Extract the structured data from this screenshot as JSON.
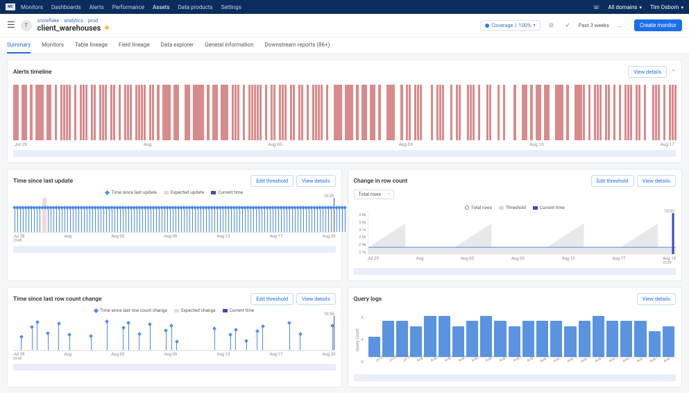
{
  "topnav": {
    "logo_text": "MC",
    "items": [
      "Monitors",
      "Dashboards",
      "Alerts",
      "Performance",
      "Assets",
      "Data products",
      "Settings"
    ],
    "active_index": 4,
    "domain_label": "All domains",
    "user_name": "Tim Osborn"
  },
  "header": {
    "avatar_initial": "T",
    "breadcrumb": [
      "snowflake",
      "analytics",
      "prod"
    ],
    "title": "client_warehouses",
    "coverage_label": "Coverage",
    "coverage_value": "100%",
    "date_range": "Past 3 weeks",
    "create_button": "Create monitor"
  },
  "tabs": {
    "items": [
      "Summary",
      "Monitors",
      "Table lineage",
      "Field lineage",
      "Data explorer",
      "General information",
      "Downstream reports (86+)"
    ],
    "active_index": 0
  },
  "buttons": {
    "view_details": "View details",
    "edit_threshold": "Edit threshold"
  },
  "legends": {
    "time_since_update": [
      "Time since last update",
      "Expected update",
      "Current time"
    ],
    "row_count": [
      "Total rows",
      "Threshold",
      "Current time"
    ],
    "rc_change": [
      "Time since last row count change",
      "Expected change",
      "Current time"
    ]
  },
  "alerts_card": {
    "title": "Alerts timeline",
    "x_ticks": [
      "Jul 29",
      "Aug",
      "Aug 05",
      "Aug 09",
      "Aug 13",
      "Aug 17"
    ]
  },
  "tsu_card": {
    "title": "Time since last update",
    "current_time_label": "10:35",
    "x_ticks": [
      "Jul 28",
      "Aug",
      "Aug 05",
      "Aug 09",
      "Aug 13",
      "Aug 17",
      "Aug 20"
    ],
    "x_tick_sub_first": "23:45"
  },
  "rowcount_card": {
    "title": "Change in row count",
    "selector": "Total rows",
    "current_time_label": "10:35",
    "y_ticks": [
      "3.8k",
      "3.5k",
      "3.1k",
      "2.8k",
      "2.4k",
      "2.1k"
    ],
    "x_ticks": [
      "Jul 29",
      "Aug",
      "Aug 05",
      "Aug 09",
      "Aug 13",
      "Aug 17",
      "Aug 19"
    ],
    "x_tick_sub_last": "23:59"
  },
  "rcchange_card": {
    "title": "Time since last row count change",
    "current_time_label": "10:35",
    "x_ticks": [
      "Jul 28",
      "Aug",
      "Aug 05",
      "Aug 09",
      "Aug 13",
      "Aug 17",
      "Aug 20"
    ],
    "x_tick_sub_first": "23:45"
  },
  "querylogs_card": {
    "title": "Query logs",
    "y_label": "Query Count",
    "y_ticks": [
      "8",
      "4",
      "0"
    ]
  },
  "chart_data": [
    {
      "id": "alerts_timeline",
      "type": "bar",
      "title": "Alerts timeline",
      "xlabel": "",
      "ylabel": "",
      "note": "presence bars; 1 = alert fired in that slot, 0 = none; approx hourly slots over ~3 weeks",
      "values": [
        1,
        1,
        0,
        1,
        1,
        0,
        1,
        0,
        1,
        1,
        1,
        0,
        1,
        1,
        0,
        1,
        0,
        1,
        1,
        1,
        1,
        0,
        1,
        0,
        1,
        1,
        1,
        0,
        1,
        1,
        0,
        1,
        1,
        1,
        0,
        1,
        1,
        0,
        1,
        0,
        1,
        1,
        1,
        0,
        1,
        1,
        1,
        1,
        0,
        1,
        1,
        0,
        1,
        0,
        1,
        1,
        1,
        0,
        1,
        1,
        0,
        0,
        1,
        1,
        0,
        1,
        1,
        1,
        1,
        0,
        1,
        0,
        1,
        1,
        0,
        1,
        1,
        1,
        0,
        1,
        1,
        1,
        0,
        1,
        0,
        1,
        1,
        1,
        1,
        1,
        0,
        1,
        0,
        1,
        1,
        0,
        1,
        1,
        1,
        0,
        1,
        1,
        0,
        1,
        1,
        0,
        1,
        0,
        1,
        1,
        1,
        1,
        0,
        1,
        0,
        0,
        1,
        1,
        1,
        0,
        1,
        1,
        1,
        0,
        1,
        0,
        1,
        1,
        0,
        1,
        1,
        0,
        1,
        0,
        0,
        1,
        1,
        1,
        0,
        0,
        1,
        0,
        1,
        1,
        0,
        1,
        1,
        1,
        0,
        0,
        0,
        1,
        0,
        1,
        1,
        1,
        0,
        0,
        1,
        0,
        1,
        1,
        0,
        0,
        1,
        1,
        1,
        0,
        1,
        0,
        0,
        1,
        1,
        0,
        0,
        1,
        0,
        1,
        0,
        0,
        0,
        1,
        0,
        0,
        1,
        1,
        0,
        1,
        0,
        1,
        1,
        0,
        1,
        1,
        0,
        0,
        1,
        1,
        1,
        0,
        1,
        0,
        0,
        1,
        1,
        1,
        1,
        0,
        1,
        0,
        1,
        1,
        1,
        0,
        1,
        1,
        0,
        1,
        0,
        1,
        0,
        1,
        1,
        1,
        0,
        1,
        1,
        0,
        1,
        0,
        0,
        1,
        1,
        1,
        0,
        1,
        0,
        1,
        1,
        1
      ],
      "x_ticks": [
        "Jul 29",
        "Aug",
        "Aug 05",
        "Aug 09",
        "Aug 13",
        "Aug 17"
      ]
    },
    {
      "id": "time_since_last_update",
      "type": "bar",
      "title": "Time since last update",
      "series": [
        {
          "name": "Time since last update",
          "note": "dense hourly bars, roughly constant ~1h",
          "approx_value": 1.0,
          "count": 120
        },
        {
          "name": "Expected update",
          "approx_value": 1.0
        },
        {
          "name": "Current time",
          "value": "10:35"
        }
      ],
      "anomaly_highlight": {
        "approx_date": "Jul 30",
        "note": "single pink highlighted bar"
      },
      "x_ticks": [
        "Jul 28",
        "Aug",
        "Aug 05",
        "Aug 09",
        "Aug 13",
        "Aug 17",
        "Aug 20"
      ]
    },
    {
      "id": "change_in_row_count",
      "type": "area",
      "title": "Change in row count",
      "series": [
        {
          "name": "Total rows",
          "approx_values": [
            2400,
            2400,
            2400,
            2400,
            2400,
            2410,
            2410,
            2400,
            2400,
            2410,
            2400,
            2400,
            2410,
            2400,
            2400,
            2400,
            2400,
            2410,
            2400,
            2400
          ]
        },
        {
          "name": "Threshold",
          "note": "grey sawtooth envelope ramps rising from ~2400 to ~3600 and resetting, 5 cycles"
        },
        {
          "name": "Current time",
          "value": "10:35"
        }
      ],
      "ylim": [
        2100,
        3800
      ],
      "x_ticks": [
        "Jul 29",
        "Aug",
        "Aug 05",
        "Aug 09",
        "Aug 13",
        "Aug 17",
        "Aug 19"
      ]
    },
    {
      "id": "time_since_last_row_count_change",
      "type": "scatter",
      "title": "Time since last row count change",
      "series": [
        {
          "name": "Time since last row count change",
          "note": "sparse points with stems, scattered across Jul 28–Aug 20 at irregular intervals"
        },
        {
          "name": "Expected change"
        },
        {
          "name": "Current time",
          "value": "10:35"
        }
      ],
      "x_ticks": [
        "Jul 28",
        "Aug",
        "Aug 05",
        "Aug 09",
        "Aug 13",
        "Aug 17",
        "Aug 20"
      ]
    },
    {
      "id": "query_logs",
      "type": "bar",
      "title": "Query logs",
      "ylabel": "Query Count",
      "ylim": [
        0,
        8
      ],
      "categories": [
        "Jul 29",
        "Jul 30",
        "Jul 31",
        "Aug 1",
        "Aug 2",
        "Aug 3",
        "Aug 4",
        "Aug 5",
        "Aug 6",
        "Aug 7",
        "Aug 8",
        "Aug 9",
        "Aug 10",
        "Aug 11",
        "Aug 12",
        "Aug 13",
        "Aug 14",
        "Aug 15",
        "Aug 16",
        "Aug 17",
        "Aug 18",
        "Aug 19"
      ],
      "values": [
        4,
        7,
        7,
        6,
        8,
        8,
        6,
        7,
        8,
        7,
        6,
        7,
        7,
        7,
        6,
        7,
        8,
        7,
        7,
        7,
        5,
        6
      ]
    }
  ]
}
